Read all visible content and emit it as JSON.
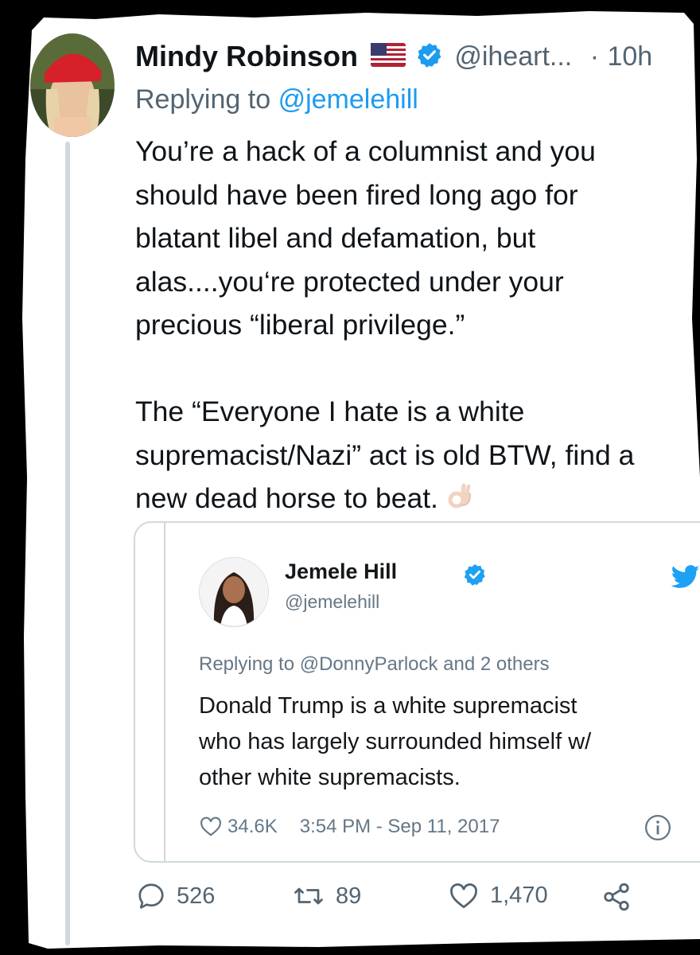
{
  "tweet": {
    "author_name": "Mindy Robinson",
    "flag_icon": "us-flag-icon",
    "verified_icon": "verified-badge-icon",
    "handle": "@iheart...",
    "separator": "·",
    "time": "10h",
    "replying_prefix": "Replying to",
    "replying_to": "@jemelehill",
    "text_lines": [
      "You’re a hack of a columnist and you",
      "should have been fired long ago for",
      "blatant libel and defamation, but",
      "alas....you‘re protected under your",
      "precious “liberal privilege.”",
      "",
      "The “Everyone I hate is a white",
      "supremacist/Nazi” act is old BTW, find a",
      "new dead horse to beat."
    ],
    "emoji": "ok-hand-emoji"
  },
  "quoted": {
    "author_name": "Jemele Hill",
    "handle": "@jemelehill",
    "replying": "Replying to @DonnyParlock and 2 others",
    "text_lines": [
      "Donald Trump is a white supremacist",
      "who has largely surrounded himself w/",
      "other white supremacists."
    ],
    "likes": "34.6K",
    "timestamp": "3:54 PM - Sep 11, 2017",
    "brand_icon": "twitter-bird-icon",
    "brand_color": "#1da1f2"
  },
  "actions": {
    "replies": "526",
    "retweets": "89",
    "likes": "1,470"
  },
  "colors": {
    "link": "#1d9bf0",
    "secondary_text": "#536471",
    "thread_line": "#cfd9de",
    "background": "#000000"
  }
}
